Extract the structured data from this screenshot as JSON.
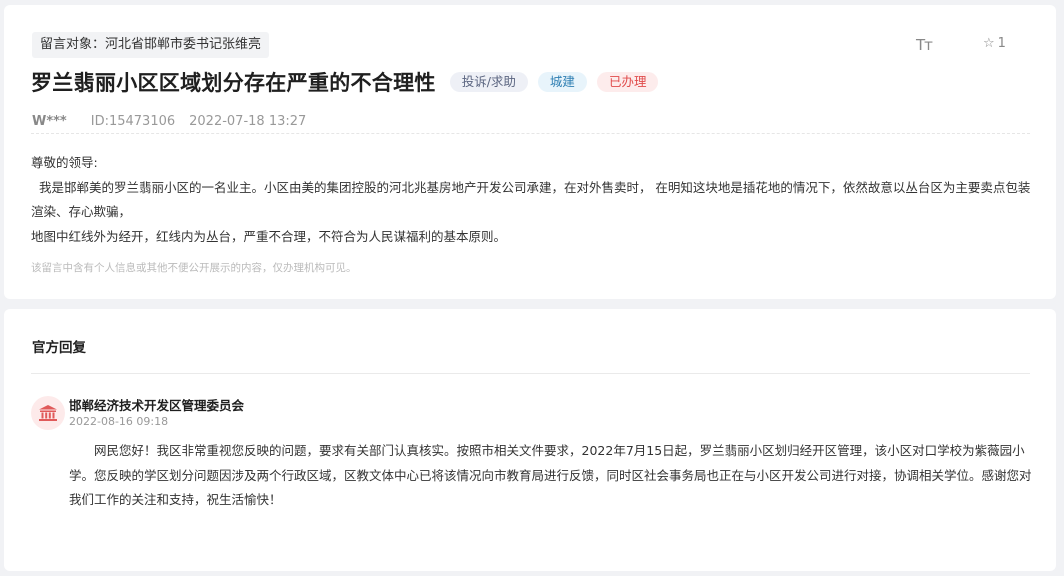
{
  "message": {
    "target": "留言对象：河北省邯郸市委书记张维亮",
    "tools": {
      "font_size_icon": "Tт",
      "star_icon": "☆",
      "star_count": "1"
    },
    "title": "罗兰翡丽小区区域划分存在严重的不合理性",
    "badges": {
      "type": "投诉/求助",
      "category": "城建",
      "status": "已办理"
    },
    "user": "W***",
    "id": "ID:15473106",
    "datetime": "2022-07-18 13:27",
    "body": [
      "尊敬的领导:",
      "  我是邯郸美的罗兰翡丽小区的一名业主。小区由美的集团控股的河北兆基房地产开发公司承建，在对外售卖时， 在明知这块地是插花地的情况下，依然故意以丛台区为主要卖点包装渲染、存心欺骗，",
      "地图中红线外为经开，红线内为丛台，严重不合理，不符合为人民谋福利的基本原则。"
    ],
    "notice": "该留言中含有个人信息或其他不便公开展示的内容，仅办理机构可见。"
  },
  "reply": {
    "section_title": "官方回复",
    "org_icon": "government-building-icon",
    "org": "邯郸经济技术开发区管理委员会",
    "datetime": "2022-08-16 09:18",
    "body": "网民您好！我区非常重视您反映的问题，要求有关部门认真核实。按照市相关文件要求，2022年7月15日起，罗兰翡丽小区划归经开区管理，该小区对口学校为紫薇园小学。您反映的学区划分问题因涉及两个行政区域，区教文体中心已将该情况向市教育局进行反馈，同时区社会事务局也正在与小区开发公司进行对接，协调相关学位。感谢您对我们工作的关注和支持，祝生活愉快！"
  },
  "colors": {
    "status_red": "#e04b4b",
    "category_blue": "#2f7fb3",
    "avatar_red": "#e05a5a"
  }
}
